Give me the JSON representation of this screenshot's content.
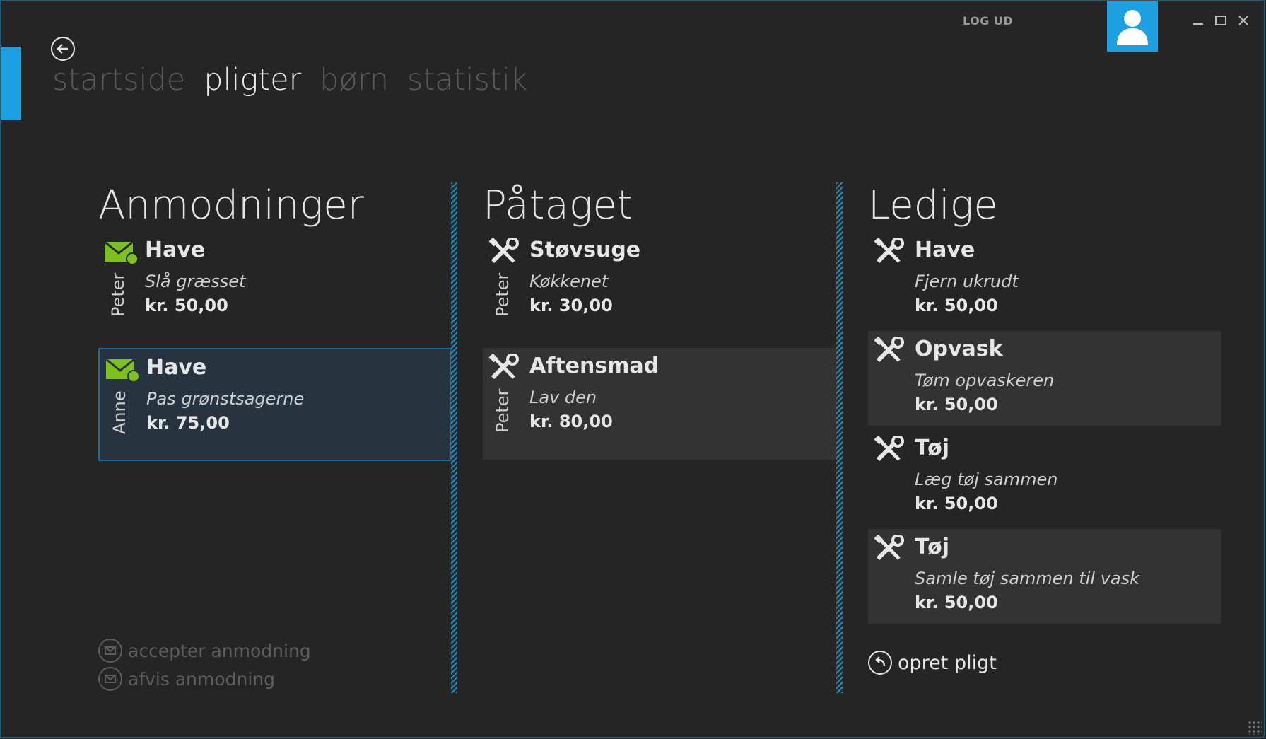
{
  "nav": {
    "tabs": [
      "startside",
      "pligter",
      "børn",
      "statistik"
    ],
    "active_tab": "pligter"
  },
  "header": {
    "logout_label": "LOG UD"
  },
  "columns": {
    "requests": {
      "title": "Anmodninger",
      "items": [
        {
          "title": "Have",
          "desc": "Slå græsset",
          "price": "kr. 50,00",
          "person": "Peter",
          "icon": "mail-icon"
        },
        {
          "title": "Have",
          "desc": "Pas grønstsagerne",
          "price": "kr. 75,00",
          "person": "Anne",
          "icon": "mail-icon",
          "selected": true
        }
      ]
    },
    "taken": {
      "title": "Påtaget",
      "items": [
        {
          "title": "Støvsuge",
          "desc": "Køkkenet",
          "price": "kr. 30,00",
          "person": "Peter",
          "icon": "tools-icon"
        },
        {
          "title": "Aftensmad",
          "desc": "Lav den",
          "price": "kr. 80,00",
          "person": "Peter",
          "icon": "tools-icon"
        }
      ]
    },
    "available": {
      "title": "Ledige",
      "items": [
        {
          "title": "Have",
          "desc": "Fjern ukrudt",
          "price": "kr. 50,00",
          "icon": "tools-icon"
        },
        {
          "title": "Opvask",
          "desc": "Tøm opvaskeren",
          "price": "kr. 50,00",
          "icon": "tools-icon"
        },
        {
          "title": "Tøj",
          "desc": "Læg tøj sammen",
          "price": "kr. 50,00",
          "icon": "tools-icon"
        },
        {
          "title": "Tøj",
          "desc": "Samle tøj sammen til vask",
          "price": "kr. 50,00",
          "icon": "tools-icon"
        }
      ]
    }
  },
  "actions": {
    "accept_label": "accepter anmodning",
    "reject_label": "afvis anmodning",
    "create_label": "opret pligt"
  },
  "colors": {
    "accent": "#1ba1e2",
    "mail_icon": "#7cc11c",
    "background": "#252526",
    "card_fill": "#333334"
  }
}
